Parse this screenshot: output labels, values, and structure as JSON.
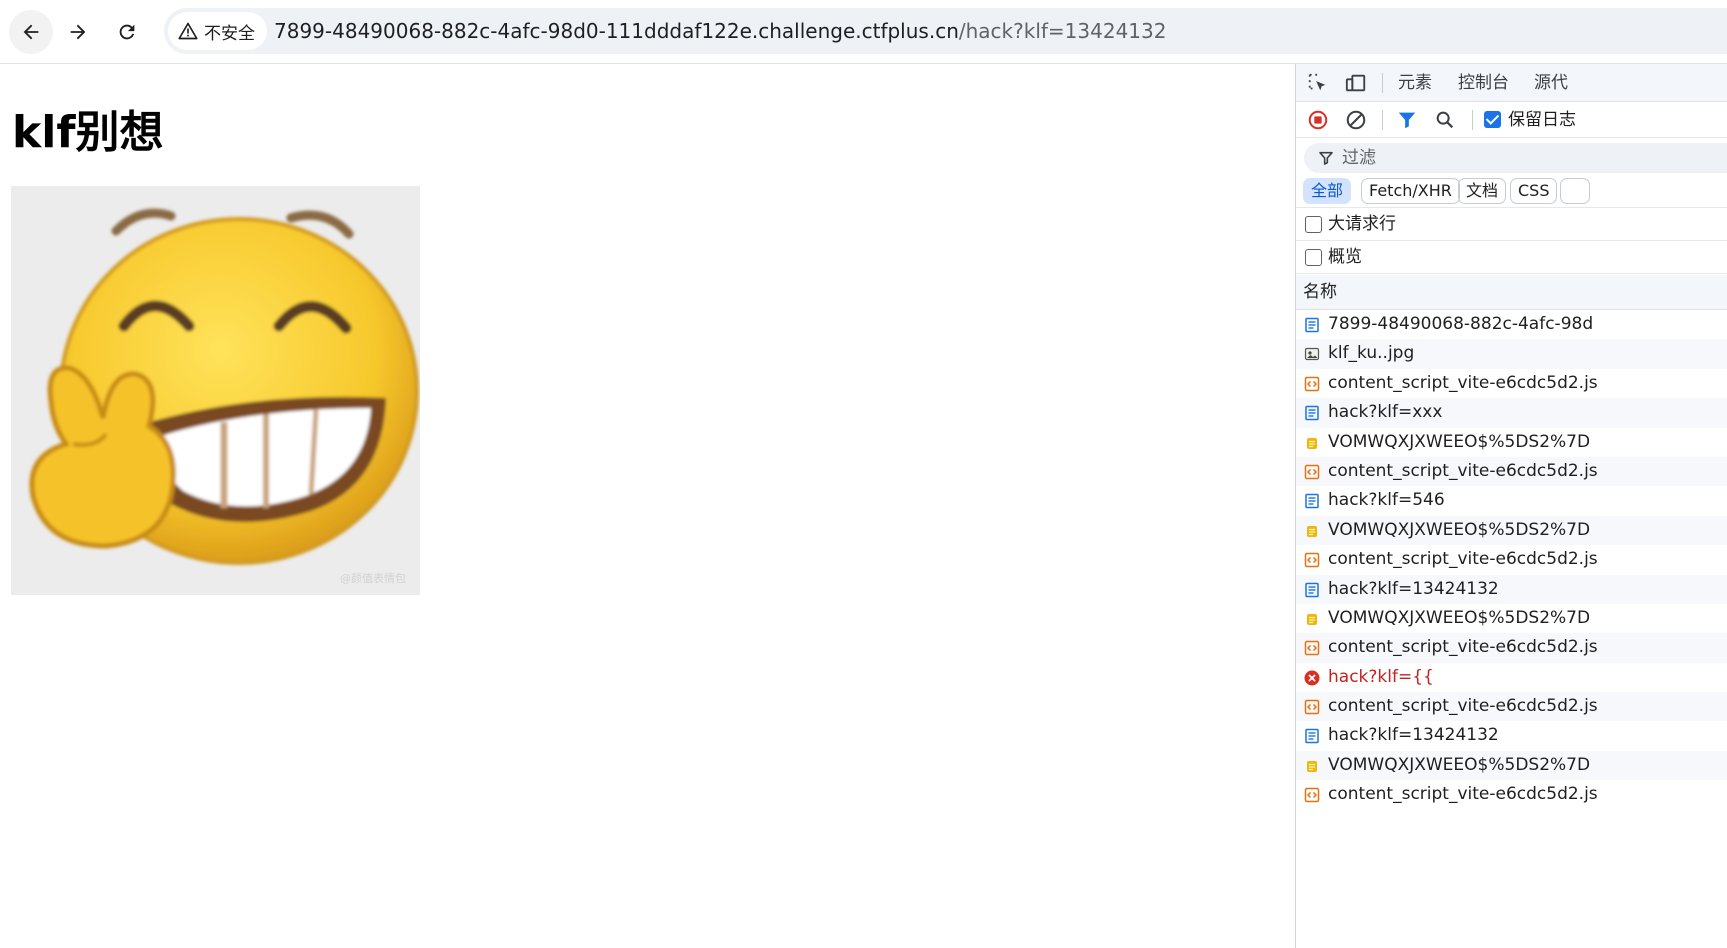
{
  "browser": {
    "security_label": "不安全",
    "url_host": "7899-48490068-882c-4afc-98d0-111dddaf122e.challenge.ctfplus.cn",
    "url_path": "/hack?klf=13424132"
  },
  "page": {
    "title": "klf别想",
    "image": {
      "name": "laughing-emoji-image",
      "watermark": "@颜值表情包"
    }
  },
  "devtools": {
    "tabs": [
      "元素",
      "控制台",
      "源代"
    ],
    "preserve_log_label": "保留日志",
    "preserve_log_checked": true,
    "filter_placeholder": "过滤",
    "type_filters": [
      "全部",
      "Fetch/XHR",
      "文档",
      "CSS"
    ],
    "active_type_filter": "全部",
    "big_request_rows_label": "大请求行",
    "big_request_rows_checked": false,
    "overview_label": "概览",
    "overview_checked": false,
    "name_column_header": "名称",
    "requests": [
      {
        "name": "7899-48490068-882c-4afc-98d",
        "type": "document"
      },
      {
        "name": "klf_ku..jpg",
        "type": "image"
      },
      {
        "name": "content_script_vite-e6cdc5d2.js",
        "type": "script"
      },
      {
        "name": "hack?klf=xxx",
        "type": "document"
      },
      {
        "name": "VOMWQXJXWEEO$%5DS2%7D",
        "type": "manifest"
      },
      {
        "name": "content_script_vite-e6cdc5d2.js",
        "type": "script"
      },
      {
        "name": "hack?klf=546",
        "type": "document"
      },
      {
        "name": "VOMWQXJXWEEO$%5DS2%7D",
        "type": "manifest"
      },
      {
        "name": "content_script_vite-e6cdc5d2.js",
        "type": "script"
      },
      {
        "name": "hack?klf=13424132",
        "type": "document"
      },
      {
        "name": "VOMWQXJXWEEO$%5DS2%7D",
        "type": "manifest"
      },
      {
        "name": "content_script_vite-e6cdc5d2.js",
        "type": "script"
      },
      {
        "name": "hack?klf={{",
        "type": "error"
      },
      {
        "name": "content_script_vite-e6cdc5d2.js",
        "type": "script"
      },
      {
        "name": "hack?klf=13424132",
        "type": "document"
      },
      {
        "name": "VOMWQXJXWEEO$%5DS2%7D",
        "type": "manifest"
      },
      {
        "name": "content_script_vite-e6cdc5d2.js",
        "type": "script"
      }
    ]
  },
  "colors": {
    "document_icon": "#1a73e8",
    "script_icon": "#e8710a",
    "manifest_icon": "#f2b705",
    "error_icon": "#d93025",
    "error_text": "#c5221f"
  }
}
